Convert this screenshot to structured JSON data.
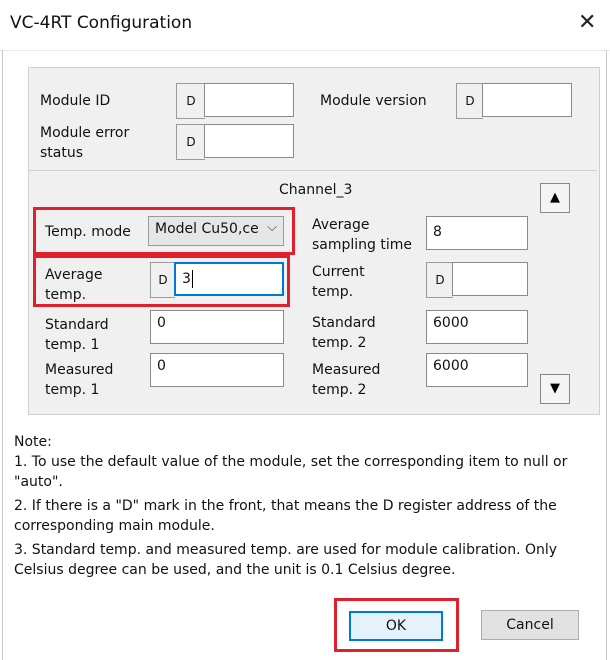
{
  "window": {
    "title": "VC-4RT Configuration",
    "close_glyph": "✕"
  },
  "module": {
    "id_label": "Module ID",
    "version_label": "Module version",
    "error_status_label_line1": "Module error",
    "error_status_label_line2": "status",
    "d_prefix": "D",
    "id_value": "",
    "version_value": "",
    "error_status_value": ""
  },
  "channel": {
    "title": "Channel_3",
    "temp_mode_label": "Temp. mode",
    "temp_mode_value": "Model Cu50,ce",
    "avg_sampling_label_line1": "Average",
    "avg_sampling_label_line2": "sampling time",
    "avg_sampling_value": "8",
    "avg_temp_label_line1": "Average",
    "avg_temp_label_line2": "temp.",
    "avg_temp_value": "3",
    "current_temp_label_line1": "Current",
    "current_temp_label_line2": "temp.",
    "current_temp_value": "",
    "std_temp1_label_line1": "Standard",
    "std_temp1_label_line2": "temp. 1",
    "std_temp1_value": "0",
    "std_temp2_label_line1": "Standard",
    "std_temp2_label_line2": "temp. 2",
    "std_temp2_value": "6000",
    "meas_temp1_label_line1": "Measured",
    "meas_temp1_label_line2": "temp. 1",
    "meas_temp1_value": "0",
    "meas_temp2_label_line1": "Measured",
    "meas_temp2_label_line2": "temp. 2",
    "meas_temp2_value": "6000",
    "up_arrow": "▲",
    "down_arrow": "▼"
  },
  "notes": {
    "heading": "Note:",
    "items": [
      "1. To use the default value of the module, set the corresponding item to null or \"auto\".",
      "2. If there is a \"D\" mark in the front, that means the D register address of the corresponding main module.",
      "3. Standard temp. and measured temp. are used for module calibration. Only Celsius degree can be used, and the unit is 0.1 Celsius degree."
    ]
  },
  "buttons": {
    "ok": "OK",
    "cancel": "Cancel"
  },
  "colors": {
    "highlight": "#e0202c",
    "focus": "#0078d7"
  }
}
